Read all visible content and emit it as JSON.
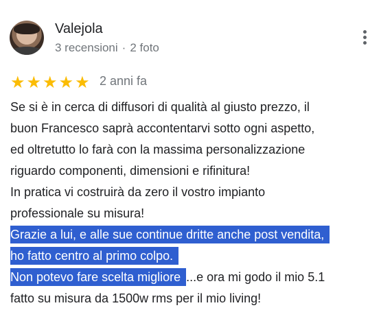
{
  "reviewer": {
    "name": "Valejola",
    "reviews": "3 recensioni",
    "separator": "·",
    "photos": "2 foto"
  },
  "rating": {
    "stars": 5,
    "max": 5,
    "star_color": "#fbbc04",
    "time": "2 anni fa"
  },
  "review": {
    "line1": "Se si è in cerca di diffusori di qualità al giusto prezzo, il",
    "line2": "buon Francesco saprà accontentarvi sotto ogni aspetto,",
    "line3": "ed oltretutto lo farà con la massima personalizzazione",
    "line4": "riguardo componenti, dimensioni e rifinitura!",
    "line5": "In pratica vi costruirà da zero il vostro impianto",
    "line6": "professionale su misura!",
    "line7_selected": "Grazie a lui, e alle sue continue dritte anche post vendita,",
    "line8_selected": "ho fatto centro al primo colpo.",
    "line9_selected": "Non potevo fare scelta migliore",
    "line9_rest": "...e ora mi godo il mio 5.1",
    "line10": "fatto su misura da 1500w rms per il mio living!"
  },
  "selection_color": "#2f5fd0",
  "icons": {
    "menu": "more-vert-icon",
    "star": "star-icon"
  }
}
